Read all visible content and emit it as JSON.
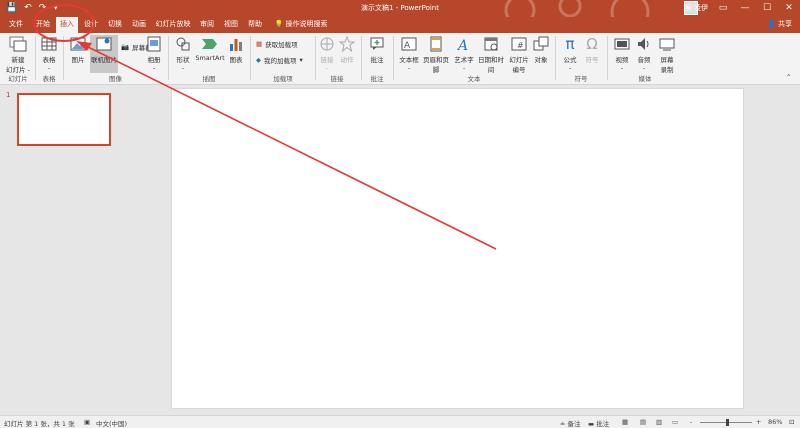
{
  "window": {
    "title": "演示文稿1 - PowerPoint",
    "user": "吴 凌伊",
    "share": "共享",
    "controls": {
      "minimize": "—",
      "maximize": "☐",
      "close": "✕"
    }
  },
  "qat": {
    "save": "💾",
    "undo": "↶",
    "redo": "↷",
    "customize": "▾"
  },
  "tabs": [
    {
      "id": "file",
      "label": "文件"
    },
    {
      "id": "home",
      "label": "开始"
    },
    {
      "id": "insert",
      "label": "插入"
    },
    {
      "id": "design",
      "label": "设计"
    },
    {
      "id": "transitions",
      "label": "切换"
    },
    {
      "id": "animations",
      "label": "动画"
    },
    {
      "id": "slideshow",
      "label": "幻灯片放映"
    },
    {
      "id": "review",
      "label": "审阅"
    },
    {
      "id": "view",
      "label": "视图"
    },
    {
      "id": "help",
      "label": "帮助"
    },
    {
      "id": "tellme",
      "label": "操作说明搜索"
    }
  ],
  "ribbon": {
    "new_slide": "新建\n幻灯片 -",
    "table": "表格\n-",
    "picture": "图片",
    "online_picture": "联机图片",
    "screenshot": "屏幕截图",
    "album": "相册\n-",
    "shapes": "形状\n-",
    "smartart": "SmartArt",
    "chart": "图表",
    "get_addins": "获取加载项",
    "my_addins": "我的加载项",
    "link": "链接\n-",
    "action": "动作",
    "comment": "批注",
    "textbox": "文本框\n-",
    "header_footer": "页眉和页脚",
    "wordart": "艺术字\n-",
    "datetime": "日期和时间",
    "slide_number": "幻灯片\n编号",
    "object": "对象",
    "equation": "公式\n-",
    "symbol": "符号",
    "video": "视频\n-",
    "audio": "音频\n-",
    "screen_recording": "屏幕\n录制",
    "groups": {
      "slides": "幻灯片",
      "tables": "表格",
      "images": "图像",
      "illustrations": "插图",
      "addins": "加载项",
      "links": "链接",
      "comments": "批注",
      "text": "文本",
      "symbols": "符号",
      "media": "媒体"
    }
  },
  "slides": [
    {
      "number": "1"
    }
  ],
  "status": {
    "slide_info": "幻灯片 第 1 张，共 1 张",
    "language": "中文(中国)",
    "notes": "备注",
    "comments": "批注",
    "zoom": "86%",
    "minus": "-",
    "plus": "+"
  },
  "colors": {
    "accent": "#b7472a",
    "annotation": "#e53935"
  }
}
